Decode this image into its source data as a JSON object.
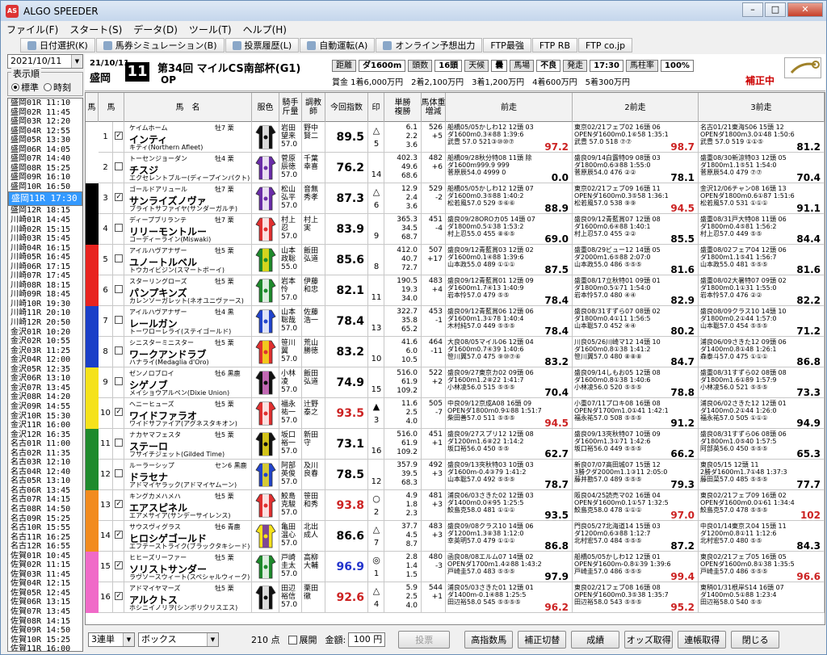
{
  "app": {
    "title": "ALGO SPEEDER",
    "icon": "AS"
  },
  "window_buttons": {
    "minimize": "0",
    "maximize": "1",
    "close": "r"
  },
  "menu": [
    "ファイル(F)",
    "スタート(S)",
    "データ(D)",
    "ツール(T)",
    "ヘルプ(H)"
  ],
  "toolbar": [
    "日付選択(K)",
    "馬券シミュレーション(B)",
    "投票履歴(L)",
    "自動運転(A)",
    "オンライン予想出力",
    "FTP最強",
    "FTP RB",
    "FTP co.jp"
  ],
  "left": {
    "date": "2021/10/11",
    "display_label": "表示順",
    "opt_standard": "標準",
    "opt_time": "時刻",
    "races": [
      "盛岡01R 11:10",
      "盛岡02R 11:45",
      "盛岡03R 12:20",
      "盛岡04R 12:55",
      "盛岡05R 13:30",
      "盛岡06R 14:05",
      "盛岡07R 14:40",
      "盛岡08R 15:25",
      "盛岡09R 16:10",
      "盛岡10R 16:50",
      "盛岡11R 17:30",
      "盛岡12R 18:15",
      "川崎01R 14:45",
      "川崎02R 15:15",
      "川崎03R 15:45",
      "川崎04R 16:15",
      "川崎05R 16:45",
      "川崎06R 17:15",
      "川崎07R 17:45",
      "川崎08R 18:15",
      "川崎09R 18:45",
      "川崎10R 19:30",
      "川崎11R 20:10",
      "川崎12R 20:50",
      "金沢01R 10:20",
      "金沢02R 10:55",
      "金沢03R 11:25",
      "金沢04R 12:00",
      "金沢05R 12:35",
      "金沢06R 13:10",
      "金沢07R 13:45",
      "金沢08R 14:20",
      "金沢09R 14:55",
      "金沢10R 15:30",
      "金沢11R 16:00",
      "金沢12R 16:35",
      "名古01R 11:00",
      "名古02R 11:35",
      "名古03R 12:10",
      "名古04R 12:40",
      "名古05R 13:10",
      "名古06R 13:45",
      "名古07R 14:15",
      "名古08R 14:50",
      "名古09R 15:25",
      "名古10R 15:55",
      "名古11R 16:25",
      "名古12R 16:55",
      "佐賀01R 10:45",
      "佐賀02R 11:15",
      "佐賀03R 11:45",
      "佐賀04R 12:15",
      "佐賀05R 12:45",
      "佐賀06R 13:15",
      "佐賀07R 13:45",
      "佐賀08R 14:15",
      "佐賀09R 14:50",
      "佐賀10R 15:25",
      "佐賀11R 16:00"
    ],
    "selected_index": 10
  },
  "header": {
    "date": "21/10/11",
    "course": "盛岡",
    "race_number": "11",
    "race_name": "第34回 マイルCS南部杯(G1)",
    "grade": "OP",
    "distance_label": "距離",
    "distance": "ダ1600m",
    "runners_label": "頭数",
    "runners": "16頭",
    "weather_label": "天候",
    "weather": "曇",
    "track_label": "馬場",
    "track": "不良",
    "post_label": "発走",
    "post": "17:30",
    "pillar_label": "馬柱率",
    "pillar": "100%",
    "prize": "賞金 1着6,000万円　2着2,100万円　3着1,200万円　4着600万円　5着300万円",
    "correction": "補正中"
  },
  "columns": [
    "馬",
    "馬",
    "馬　名",
    "服色",
    "騎手\n斤量",
    "調教\n師",
    "今回指数",
    "印",
    "単勝\n複勝",
    "馬体重\n増減",
    "前走",
    "2前走",
    "3前走"
  ],
  "frame_colors": [
    "#ffffff",
    "#000000",
    "#e8231f",
    "#1a3fc8",
    "#f5e21b",
    "#1e8a2c",
    "#f28b1e",
    "#f06ac8"
  ],
  "rows": [
    {
      "frame": 1,
      "num": "1",
      "check": "✓",
      "sire": "ケイムホーム",
      "sex": "牡7 栗",
      "name": "インティ",
      "dam": "キティ(Northern Afleet)",
      "jockey": "岩田\n望来\n57.0",
      "trainer": "野中\n賢二",
      "index": "89.5",
      "idx_color": "black",
      "mark": "△",
      "mark2": "5",
      "odds": "6.1\n2.2\n3.6",
      "weight": "526\n+5",
      "silk": [
        "#111",
        "#fff"
      ]
    },
    {
      "frame": 2,
      "num": "2",
      "check": "",
      "sire": "トーセンジョーダン",
      "sex": "牡4 栗",
      "name": "チスジ",
      "dam": "エクセレントブルー(ディープインパクト)",
      "jockey": "菅原\n辰徳\n57.0",
      "trainer": "千葉\n幸喜",
      "index": "76.2",
      "idx_color": "black",
      "mark": "",
      "mark2": "14",
      "odds": "402.3\n49.6\n68.6",
      "weight": "482\n+6",
      "silk": [
        "#6a2da8",
        "#fff"
      ]
    },
    {
      "frame": 3,
      "num": "3",
      "check": "✓",
      "sire": "ゴールドアリュール",
      "sex": "牡7 栗",
      "name": "サンライズノヴァ",
      "dam": "ブライトサファイヤ(サンダーガルチ)",
      "jockey": "松山\n弘平\n57.0",
      "trainer": "音無\n秀孝",
      "index": "87.3",
      "idx_color": "black",
      "mark": "△",
      "mark2": "6",
      "odds": "12.9\n2.4\n3.6",
      "weight": "529\n-2",
      "silk": [
        "#6a2da8",
        "#fff"
      ]
    },
    {
      "frame": 4,
      "num": "4",
      "check": "",
      "sire": "ディープブリランテ",
      "sex": "牡7 栗",
      "name": "リリーモントルー",
      "dam": "コーディーライン(Miswaki)",
      "jockey": "村上\n忍\n57.0",
      "trainer": "村上\n実",
      "index": "83.9",
      "idx_color": "black",
      "mark": "",
      "mark2": "9",
      "odds": "365.3\n34.5\n68.7",
      "weight": "451\n-4",
      "silk": [
        "#e03030",
        "#fff"
      ]
    },
    {
      "frame": 5,
      "num": "5",
      "check": "",
      "sire": "アイルハヴアナザー",
      "sex": "牡5 栗",
      "name": "ユノートルベル",
      "dam": "トウカイビジン(スマートボーイ)",
      "jockey": "山本\n政聡\n55.0",
      "trainer": "飯田\n弘道",
      "index": "85.6",
      "idx_color": "black",
      "mark": "",
      "mark2": "8",
      "odds": "412.0\n40.7\n72.7",
      "weight": "507\n+17",
      "silk": [
        "#1e8a2c",
        "#f5e21b"
      ]
    },
    {
      "frame": 6,
      "num": "6",
      "check": "",
      "sire": "スターリングローズ",
      "sex": "牡5 栗",
      "name": "パンプキンズ",
      "dam": "カレンソーガレット(ネオユニヴァース)",
      "jockey": "岩本\n怜\n57.0",
      "trainer": "伊藤\n和忠",
      "index": "82.1",
      "idx_color": "black",
      "mark": "",
      "mark2": "11",
      "odds": "190.5\n19.3\n34.0",
      "weight": "483\n+4",
      "silk": [
        "#1e8a2c",
        "#fff"
      ]
    },
    {
      "frame": 7,
      "num": "7",
      "check": "",
      "sire": "アイルハヴアナザー",
      "sex": "牡4 黒",
      "name": "レールガン",
      "dam": "トーワローレライ(ステイゴールド)",
      "jockey": "山本\n聡哉\n57.0",
      "trainer": "佐藤\n浩一",
      "index": "78.4",
      "idx_color": "black",
      "mark": "",
      "mark2": "13",
      "odds": "322.7\n35.8\n65.2",
      "weight": "453\n-1",
      "silk": [
        "#2244cc",
        "#fff"
      ]
    },
    {
      "frame": 8,
      "num": "8",
      "check": "",
      "sire": "シニスターミニスター",
      "sex": "牡5 栗",
      "name": "ワークアンドラブ",
      "dam": "ハナライ(Medaglia d'Oro)",
      "jockey": "笹川\n翼\n57.0",
      "trainer": "荒山\n勝徳",
      "index": "83.2",
      "idx_color": "black",
      "mark": "",
      "mark2": "10",
      "odds": "41.6\n6.0\n10.5",
      "weight": "464\n-11",
      "silk": [
        "#e03030",
        "#f5e21b"
      ]
    },
    {
      "frame": 9,
      "num": "9",
      "check": "",
      "sire": "ゼンノロブロイ",
      "sex": "牡6 黒鹿",
      "name": "シゲノブ",
      "dam": "メイショウアルペン(Dixie Union)",
      "jockey": "小林\n凌\n57.0",
      "trainer": "飯田\n弘道",
      "index": "74.9",
      "idx_color": "black",
      "mark": "",
      "mark2": "15",
      "odds": "516.0\n61.9\n109.2",
      "weight": "522\n+2",
      "silk": [
        "#111",
        "#e078d0"
      ]
    },
    {
      "frame": 10,
      "num": "10",
      "check": "✓",
      "sire": "ヘニーヒューズ",
      "sex": "牡5 栗",
      "name": "ワイドファラオ",
      "dam": "ワイドサファイア(アグネスタキオン)",
      "jockey": "福永\n祐一\n57.0",
      "trainer": "辻野\n泰之",
      "index": "93.5",
      "idx_color": "red",
      "mark": "▲",
      "mark2": "3",
      "odds": "11.6\n2.5\n4.0",
      "weight": "505\n-7",
      "silk": [
        "#e03030",
        "#fff"
      ]
    },
    {
      "frame": 11,
      "num": "11",
      "check": "",
      "sire": "ナカヤマフェスタ",
      "sex": "牡5 栗",
      "name": "ステーロ",
      "dam": "フサイチジェット(Gilded Time)",
      "jockey": "坂口\n裕一\n57.0",
      "trainer": "新田\n守",
      "index": "73.1",
      "idx_color": "black",
      "mark": "",
      "mark2": "16",
      "odds": "516.0\n61.9\n109.2",
      "weight": "451\n+1",
      "silk": [
        "#111",
        "#f5e21b"
      ]
    },
    {
      "frame": 12,
      "num": "12",
      "check": "",
      "sire": "ルーラーシップ",
      "sex": "セン6 黒鹿",
      "name": "ドラセナ",
      "dam": "アドマイヤラック(アドマイヤムーン)",
      "jockey": "阿部\n英俊\n57.0",
      "trainer": "及川\n良春",
      "index": "78.5",
      "idx_color": "black",
      "mark": "",
      "mark2": "12",
      "odds": "357.9\n39.5\n68.3",
      "weight": "492\n+3",
      "silk": [
        "#2244cc",
        "#f5e21b"
      ]
    },
    {
      "frame": 13,
      "num": "13",
      "check": "✓",
      "sire": "キングカメハメハ",
      "sex": "牡5 栗",
      "name": "エアスピネル",
      "dam": "エアメサイア(サンデーサイレンス)",
      "jockey": "鮫島\n克駿\n57.0",
      "trainer": "笹田\n和秀",
      "index": "93.8",
      "idx_color": "red",
      "mark": "○",
      "mark2": "2",
      "odds": "4.9\n1.8\n2.3",
      "weight": "481\n+3",
      "silk": [
        "#e03030",
        "#fff"
      ]
    },
    {
      "frame": 14,
      "num": "14",
      "check": "✓",
      "sire": "サウスヴィグラス",
      "sex": "牡6 青鹿",
      "name": "ヒロシゲゴールド",
      "dam": "エフテーストライク(ブラックタキシード)",
      "jockey": "亀田\n温心\n57.0",
      "trainer": "北出\n成人",
      "index": "86.6",
      "idx_color": "black",
      "mark": "△",
      "mark2": "7",
      "odds": "37.7\n4.5\n8.7",
      "weight": "483\n+3",
      "silk": [
        "#f5e21b",
        "#6a2da8"
      ]
    },
    {
      "frame": 15,
      "num": "15",
      "check": "✓",
      "sire": "ヒヒーズリーファー",
      "sex": "牡5 栗",
      "name": "ソリストサンダー",
      "dam": "ラヴソースウィート(スペシャルウィーク)",
      "jockey": "戸崎\n圭太\n57.0",
      "trainer": "高柳\n大輔",
      "index": "96.9",
      "idx_color": "blue",
      "mark": "◎",
      "mark2": "1",
      "odds": "2.8\n1.4\n1.5",
      "weight": "480\n-3",
      "silk": [
        "#1e8a2c",
        "#fff"
      ]
    },
    {
      "frame": 16,
      "num": "16",
      "check": "✓",
      "sire": "アドマイヤマーズ",
      "sex": "牡5 栗",
      "name": "アルクトス",
      "dam": "ホシニイノリヲ(シンボリクリスエス)",
      "jockey": "田辺\n裕信\n57.0",
      "trainer": "栗田\n徹",
      "index": "92.6",
      "idx_color": "red",
      "mark": "△",
      "mark2": "4",
      "odds": "5.9\n2.5\n4.0",
      "weight": "544\n+1",
      "silk": [
        "#111",
        "#fff"
      ]
    }
  ],
  "past": [
    [
      {
        "l1": "船橋05/05かしわ12 12頭 03",
        "l2": "ダ1600m0.3④88 1:39:6",
        "l3": "武豊 57.0 521③⑩⑩⑦",
        "s": "97.2",
        "red": true
      },
      {
        "l1": "東京02/21フェブ02 16頭 06",
        "l2": "OPENダ1600m0.1⑥58 1:35:1",
        "l3": "武豊 57.0 518 ⑦⑦",
        "s": "98.7",
        "red": true
      },
      {
        "l1": "名古01/21東海S06 15頭 12",
        "l2": "OPENダ1800m3.0①48 1:50:6",
        "l3": "武豊 57.0 519 ①①⑤",
        "s": "81.2",
        "red": false
      }
    ],
    [
      {
        "l1": "船橋09/28秋分特08 11頭 除",
        "l2": "ダ1600m999.9 999",
        "l3": "菅原辰54.0 4999 0",
        "s": "0.0",
        "red": false
      },
      {
        "l1": "盛良09/14白露特09 08頭 03",
        "l2": "ダ1800m0.6③88 1:55:0",
        "l3": "菅原辰54.0 476 ②②",
        "s": "78.1",
        "red": false
      },
      {
        "l1": "盛重08/30新涼特03 12頭 05",
        "l2": "ダ1800m1.1⑤51 1:54:0",
        "l3": "菅原辰54.0 479 ⑦⑦",
        "s": "70.4",
        "red": false
      }
    ],
    [
      {
        "l1": "船橋05/05かしわ12 12頭 07",
        "l2": "ダ1600m0.3⑤88 1:40:2",
        "l3": "松若風57.0 529 ⑤⑥⑥",
        "s": "88.9",
        "red": false
      },
      {
        "l1": "東京02/21フェブ09 16頭 11",
        "l2": "OPENダ1600m0.3⑤58 1:36:1",
        "l3": "松若風57.0 538 ⑨⑨",
        "s": "94.5",
        "red": true
      },
      {
        "l1": "金沢12/06チャン08 16頭 13",
        "l2": "OPENダ1800m0.6①87 1:51:6",
        "l3": "松若風57.0 531 ①①①",
        "s": "91.1",
        "red": false
      }
    ],
    [
      {
        "l1": "盛良09/28OROカ05 14頭 07",
        "l2": "ダ1800m0.5①38 1:53:2",
        "l3": "村上忍55.0 455 ⑧⑥⑤",
        "s": "69.0",
        "red": false
      },
      {
        "l1": "盛良09/12青藍賞07 12頭 08",
        "l2": "ダ1600m0.6④88 1:40:1",
        "l3": "村上忍57.0 455 ②②",
        "s": "85.5",
        "red": false
      },
      {
        "l1": "盛重08/31戸大特08 11頭 06",
        "l2": "ダ1800m0.4⑤81 1:56:2",
        "l3": "村上忍57.0 449 ⑤⑤",
        "s": "84.4",
        "red": false
      }
    ],
    [
      {
        "l1": "盛良09/12青藍賞03 12頭 02",
        "l2": "ダ1600m0.1④88 1:39:6",
        "l3": "山本政55.0 489 ①①①",
        "s": "87.5",
        "red": false
      },
      {
        "l1": "盛重08/29ビュー12 14頭 05",
        "l2": "ダ2000m1.6⑤88 2:07:0",
        "l3": "山本政55.0 486 ⑤⑤⑤",
        "s": "81.6",
        "red": false
      },
      {
        "l1": "盛重08/02フェア04 12頭 06",
        "l2": "ダ1800m1.1⑤41 1:56:7",
        "l3": "山本政55.0 481 ⑤⑤⑤",
        "s": "81.6",
        "red": false
      }
    ],
    [
      {
        "l1": "盛良09/12青藍賞01 12頭 09",
        "l2": "ダ1600m1.7④13 1:40:9",
        "l3": "岩本怜57.0 479 ⑤⑤",
        "s": "78.4",
        "red": false
      },
      {
        "l1": "盛重08/17立秋特01 09頭 01",
        "l2": "ダ1800m0.5①71 1:54:0",
        "l3": "岩本怜57.0 480 ④④",
        "s": "82.9",
        "red": false
      },
      {
        "l1": "盛重08/02大暑特07 09頭 02",
        "l2": "ダ1800m0.1①31 1:55:0",
        "l3": "岩本怜57.0 476 ②②",
        "s": "82.2",
        "red": false
      }
    ],
    [
      {
        "l1": "盛良09/12青藍賞06 12頭 06",
        "l2": "ダ1600m1.3①78 1:40:4",
        "l3": "木村純57.0 449 ⑤⑤⑤",
        "s": "78.4",
        "red": false
      },
      {
        "l1": "盛良08/31すずら07 08頭 02",
        "l2": "ダ1800m0.4①11 1:56:5",
        "l3": "山本聡57.0 452 ④④",
        "s": "80.2",
        "red": false
      },
      {
        "l1": "盛良08/09クラス10 14頭 10",
        "l2": "ダ1800m0.2①44 1:57:0",
        "l3": "山本聡57.0 454 ⑤⑤⑤",
        "s": "71.2",
        "red": false
      }
    ],
    [
      {
        "l1": "大良08/05マイル06 12頭 04",
        "l2": "ダ1600m0.7④39 1:40:6",
        "l3": "笹川翼57.0 475 ⑨⑩⑦⑥",
        "s": "83.2",
        "red": false
      },
      {
        "l1": "川良05/26川崎マ12 14頭 10",
        "l2": "ダ1600m0.8①38 1:41:2",
        "l3": "笹川翼57.0 480 ⑧⑧⑧",
        "s": "84.7",
        "red": false
      },
      {
        "l1": "浦良06/09さきた12 09頭 06",
        "l2": "ダ1400m0.8①48 1:26:1",
        "l3": "森泰斗57.0 475 ①①①",
        "s": "86.8",
        "red": false
      }
    ],
    [
      {
        "l1": "盛良09/27東京カ02 09頭 06",
        "l2": "ダ1600m1.2⑧22 1:41:7",
        "l3": "小林凌56.0 515 ⑤⑤⑤",
        "s": "70.4",
        "red": false
      },
      {
        "l1": "盛良09/14しもお05 12頭 08",
        "l2": "ダ1600m0.8①38 1:40:6",
        "l3": "小林凌56.0 520 ⑤⑤⑤",
        "s": "78.8",
        "red": false
      },
      {
        "l1": "盛重08/31すずら02 08頭 08",
        "l2": "ダ1800m1.6①89 1:57:9",
        "l3": "小林凌56.0 521 ⑤⑤⑤",
        "s": "73.3",
        "red": false
      }
    ],
    [
      {
        "l1": "中良09/12京成A08 16頭 09",
        "l2": "OPENダ1800m0.9①88 1:51:7",
        "l3": "柴田善57.0 511 ⑤⑤⑤",
        "s": "94.5",
        "red": true
      },
      {
        "l1": "小重07/11プロキ08 16頭 08",
        "l2": "OPENダ1700m1.0①41 1:42:1",
        "l3": "福永祐57.0 508 ⑤⑤⑤",
        "s": "91.2",
        "red": false
      },
      {
        "l1": "浦良06/02さきた12 12頭 01",
        "l2": "ダ1400m0.2①44 1:26:0",
        "l3": "福永祐57.0 505 ①①①",
        "s": "94.9",
        "red": false
      }
    ],
    [
      {
        "l1": "盛良09/27スプリ12 12頭 08",
        "l2": "ダ1200m1.6⑧22 1:14:2",
        "l3": "坂口裕56.0 450 ⑤⑤",
        "s": "62.7",
        "red": false
      },
      {
        "l1": "盛良09/13夾秋特07 10頭 09",
        "l2": "ダ1600m1.3①71 1:42:6",
        "l3": "坂口裕56.0 449 ⑤⑤⑤",
        "s": "66.2",
        "red": false
      },
      {
        "l1": "盛良08/31すずら06 08頭 06",
        "l2": "ダ1800m1.0⑤40 1:57:5",
        "l3": "阿部英56.0 450 ⑤⑤⑤",
        "s": "65.3",
        "red": false
      }
    ],
    [
      {
        "l1": "盛良09/13夾秋特03 10頭 03",
        "l2": "ダ1600m-0.4③79 1:41:2",
        "l3": "山本聡57.0 492 ⑤⑤⑤",
        "s": "78.7",
        "red": false
      },
      {
        "l1": "新良07/07高田城07 15頭 12",
        "l2": "3勝クダ2000m1.1③11 2:05:0",
        "l3": "藤井勘57.0 489 ⑤⑤⑤",
        "s": "79.3",
        "red": false
      },
      {
        "l1": "東良05/15 12頭 11",
        "l2": "2勝ダ1600m1.7①48 1:37:3",
        "l3": "藤田菜57.0 485 ⑤⑤⑤",
        "s": "77.7",
        "red": false
      }
    ],
    [
      {
        "l1": "浦良06/03さきた02 12頭 03",
        "l2": "ダ1400m0.0④95 1:25:5",
        "l3": "鮫島克58.0 481 ①①①",
        "s": "93.5",
        "red": false
      },
      {
        "l1": "阪良04/25読売マ02 16頭 04",
        "l2": "OPENダ1600m0.1①57 1:32:5",
        "l3": "鮫島克58.0 478 ①①①",
        "s": "97.0",
        "red": true
      },
      {
        "l1": "東良02/21フェブ09 16頭 02",
        "l2": "OPENダ1600m0.0①61 1:34:4",
        "l3": "鮫島克57.0 478 ⑤⑤⑤",
        "s": "102",
        "red": true
      }
    ],
    [
      {
        "l1": "盛良09/08クラス10 14頭 06",
        "l2": "ダ1200m1.3⑧38 1:12:0",
        "l3": "幸英明57.0 479 ①①①",
        "s": "86.8",
        "red": false
      },
      {
        "l1": "門良05/27北海道14 15頭 03",
        "l2": "ダ1200m0.6③88 1:12:7",
        "l3": "北村宏57.0 484 ⑤⑤⑤",
        "s": "87.2",
        "red": false
      },
      {
        "l1": "中良01/14東京ス04 15頭 11",
        "l2": "ダ1200m0.8①11 1:12:6",
        "l3": "北村宏57.0 480 ⑤⑤",
        "s": "84.3",
        "red": false
      }
    ],
    [
      {
        "l1": "函良08/08エルム07 14頭 02",
        "l2": "OPENダ1700m1.4②88 1:43:2",
        "l3": "戸崎圭57.0 483 ⑤⑤⑤",
        "s": "97.9",
        "red": false
      },
      {
        "l1": "船橋05/05かしわ12 12頭 01",
        "l2": "OPENダ1600m-0.8①39 1:39:6",
        "l3": "戸崎圭57.0 486 ⑤⑤⑤",
        "s": "99.4",
        "red": true
      },
      {
        "l1": "東良02/21フェブ05 16頭 05",
        "l2": "OPENダ1600m0.8①38 1:35:5",
        "l3": "戸崎圭57.0 486 ⑤⑤⑤",
        "s": "96.6",
        "red": true
      }
    ],
    [
      {
        "l1": "浦良05/03さきた01 12頭 01",
        "l2": "ダ1400m-0.1④88 1:25:5",
        "l3": "田辺裕58.0 545 ⑤⑤⑤⑤",
        "s": "96.2",
        "red": true
      },
      {
        "l1": "東良02/21フェブ08 16頭 08",
        "l2": "OPENダ1600m0.3⑤38 1:35:7",
        "l3": "田辺裕58.0 543 ⑤⑤⑤",
        "s": "95.2",
        "red": true
      },
      {
        "l1": "東稍01/31根岸S14 16頭 07",
        "l2": "ダ1400m0.5①88 1:23:4",
        "l3": "田辺裕58.0 540 ⑤⑤",
        "s": "",
        "red": false
      }
    ]
  ],
  "bottom": {
    "bet_type": "3連単",
    "bet_method": "ボックス",
    "points": "210 点",
    "expand_label": "展開",
    "amount_label": "金額:",
    "amount": "100 円",
    "vote": "投票",
    "buttons": [
      "高指数馬",
      "補正切替",
      "成績",
      "オッズ取得",
      "連帳取得",
      "閉じる"
    ]
  }
}
